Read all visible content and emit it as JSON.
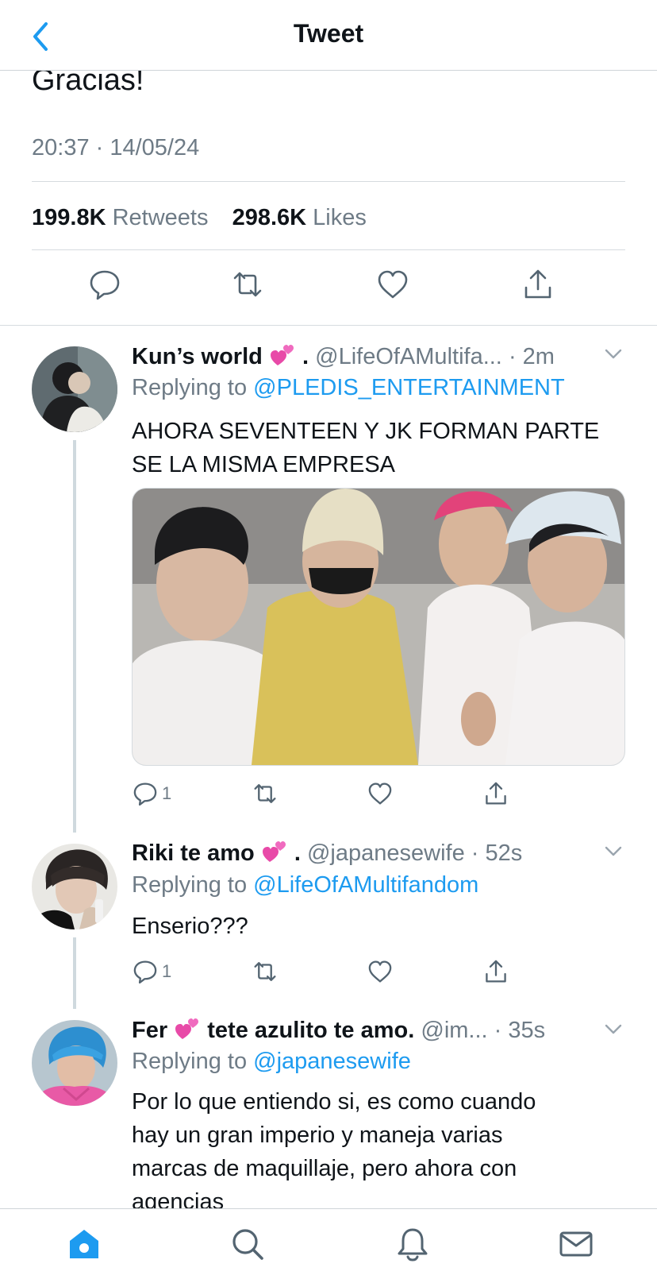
{
  "header": {
    "title": "Tweet"
  },
  "main_tweet": {
    "text_partial": "Gracias!",
    "timestamp": "20:37 · 14/05/24",
    "retweets_count": "199.8K",
    "retweets_label": "Retweets",
    "likes_count": "298.6K",
    "likes_label": "Likes"
  },
  "replies": [
    {
      "name": "Kun’s world",
      "name_suffix": ".",
      "handle": "@LifeOfAMultifa...",
      "time": "· 2m",
      "replying_prefix": "Replying to",
      "replying_to": "@PLEDIS_ENTERTAINMENT",
      "text_line1": "AHORA SEVENTEEN Y JK FORMAN PARTE",
      "text_line2": "SE LA MISMA EMPRESA",
      "reply_count": "1"
    },
    {
      "name": "Riki te amo",
      "name_suffix": ".",
      "handle": "@japanesewife",
      "time": "· 52s",
      "replying_prefix": "Replying to",
      "replying_to": "@LifeOfAMultifandom",
      "text_line1": "Enserio???",
      "reply_count": "1"
    },
    {
      "name": "Fer",
      "name_suffix": "tete azulito te amo.",
      "handle": "@im...",
      "time": "· 35s",
      "replying_prefix": "Replying to",
      "replying_to": "@japanesewife",
      "text_line1": "Por lo que entiendo si, es como cuando",
      "text_line2": "hay un gran imperio y maneja varias",
      "text_line3": "marcas de maquillaje, pero ahora con",
      "text_line4": "agencias"
    }
  ],
  "icons": {
    "back": "chevron-left-icon",
    "reply": "comment-icon",
    "retweet": "retweet-icon",
    "like": "heart-outline-icon",
    "share": "share-icon",
    "emoji": "two-hearts-emoji",
    "tabs": [
      "home-icon",
      "search-icon",
      "bell-icon",
      "mail-icon"
    ]
  },
  "colors": {
    "accent": "#1d9bf0",
    "muted": "#6e7b86",
    "text": "#0f1419",
    "emoji_pink": "#e84aa8"
  }
}
